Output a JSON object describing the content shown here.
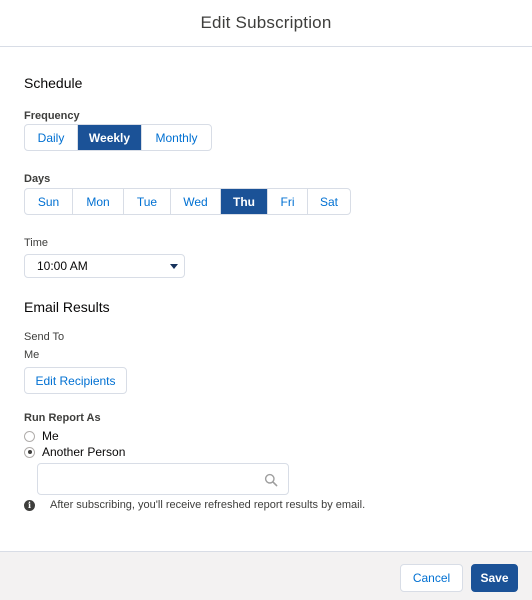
{
  "dialog": {
    "title": "Edit Subscription"
  },
  "schedule": {
    "title": "Schedule",
    "frequency_label": "Frequency",
    "frequency_options": [
      "Daily",
      "Weekly",
      "Monthly"
    ],
    "frequency_selected": "Weekly",
    "days_label": "Days",
    "days": [
      "Sun",
      "Mon",
      "Tue",
      "Wed",
      "Thu",
      "Fri",
      "Sat"
    ],
    "days_selected": "Thu",
    "time_label": "Time",
    "time_value": "10:00 AM"
  },
  "email": {
    "title": "Email Results",
    "send_to_label": "Send To",
    "send_to_value": "Me",
    "edit_recipients_label": "Edit Recipients",
    "run_as_label": "Run Report As",
    "run_as_options": [
      "Me",
      "Another Person"
    ],
    "run_as_selected": "Another Person",
    "search_placeholder": "",
    "info_text": "After subscribing, you'll receive refreshed report results by email."
  },
  "footer": {
    "cancel_label": "Cancel",
    "save_label": "Save"
  },
  "icons": {
    "search": "search-icon",
    "info": "info-icon",
    "caret": "chevron-down-icon"
  },
  "colors": {
    "brand": "#1b5297",
    "link": "#0070d2",
    "border": "#d8dde6",
    "footer_bg": "#f3f2f2"
  }
}
